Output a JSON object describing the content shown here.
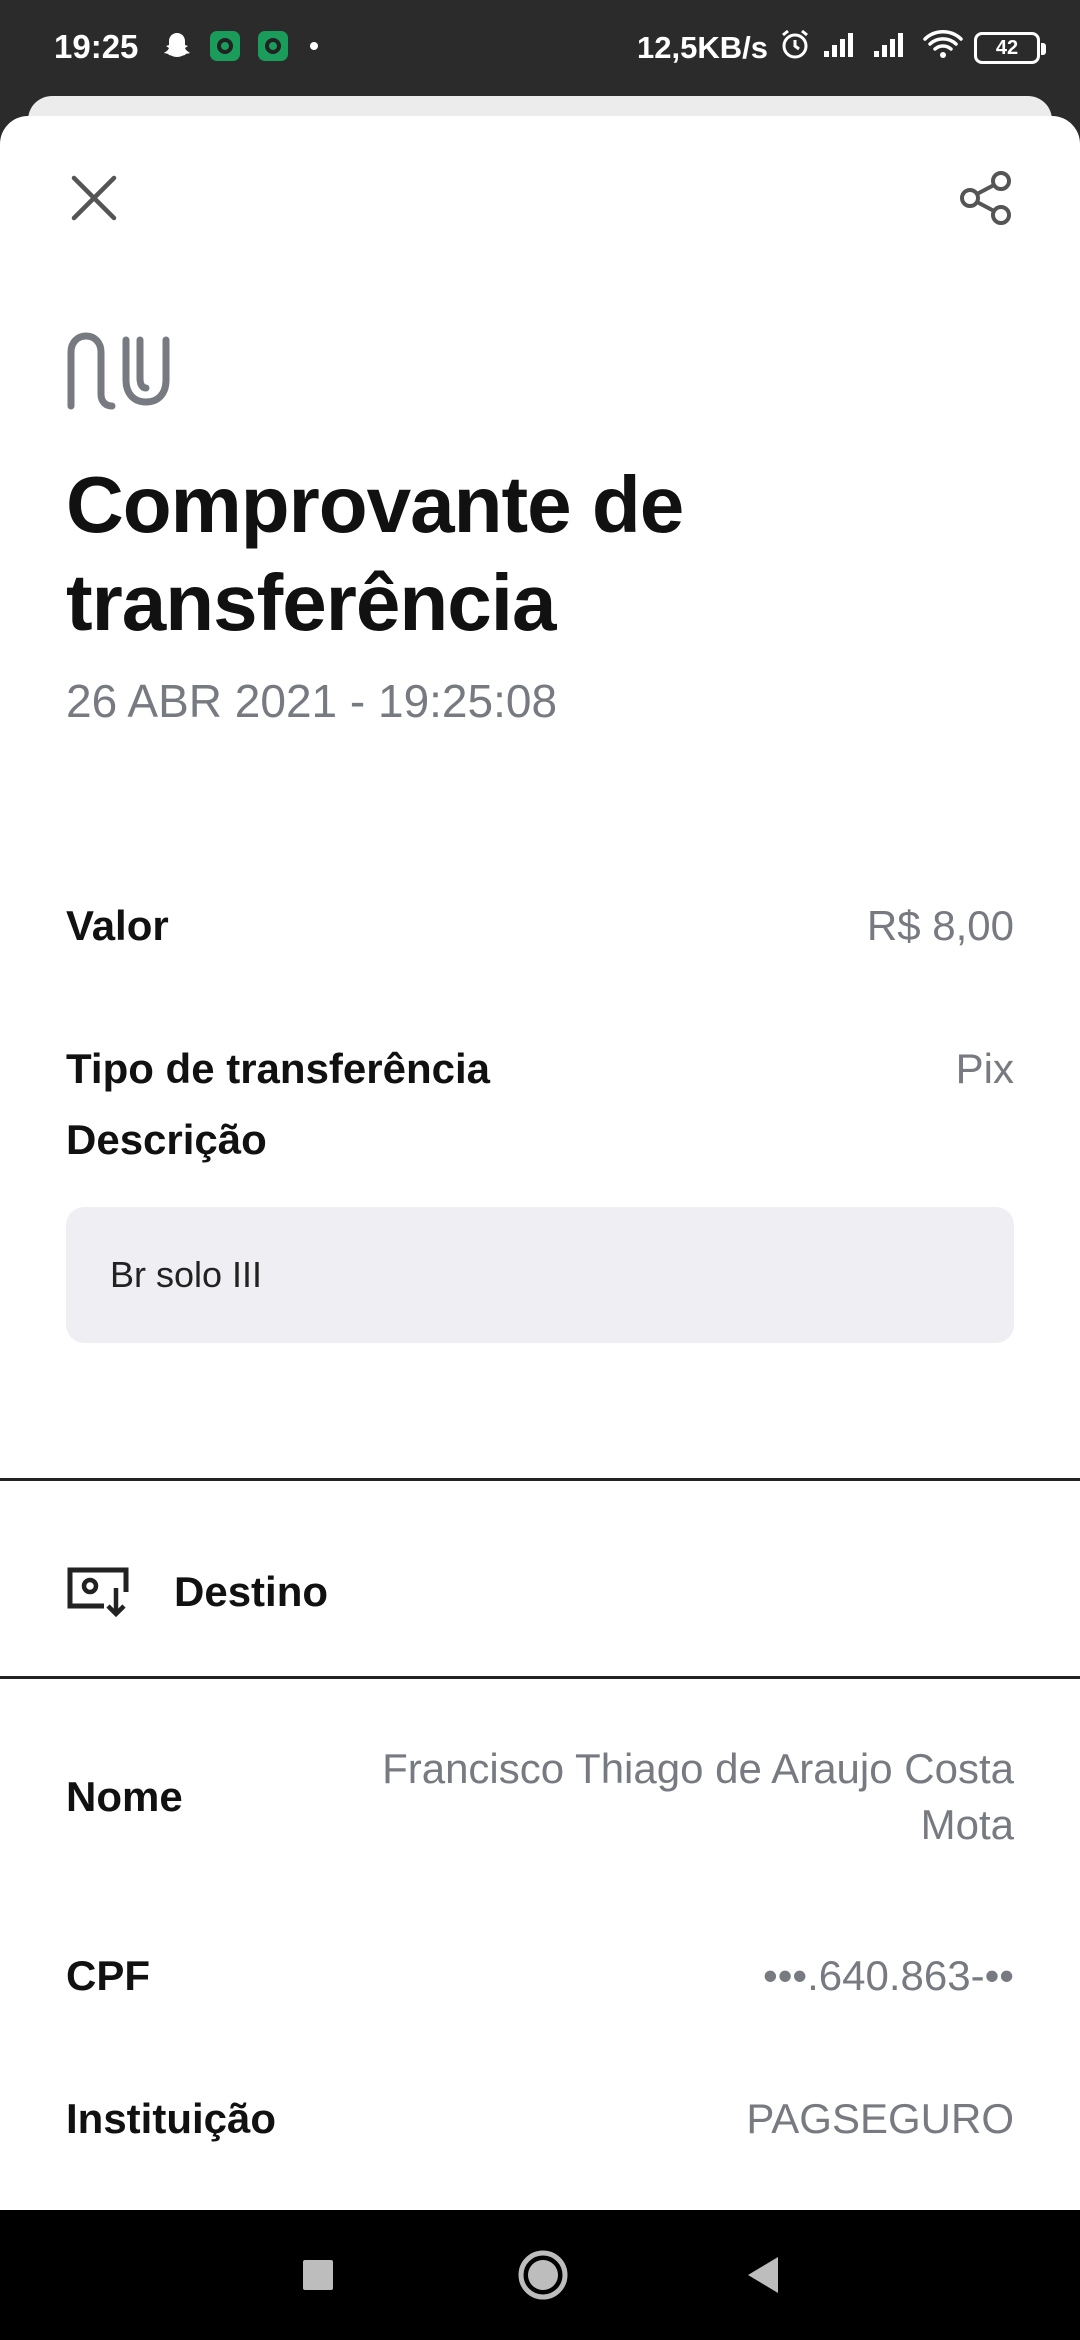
{
  "status_bar": {
    "time": "19:25",
    "network_speed": "12,5KB/s",
    "battery_level": "42",
    "notification_icons": [
      "snapchat-icon",
      "app-icon",
      "app-icon",
      "dot-icon"
    ],
    "system_icons": [
      "alarm-icon",
      "signal-icon",
      "signal-icon",
      "wifi-icon",
      "battery-icon"
    ]
  },
  "toolbar": {
    "close_icon": "close-icon",
    "share_icon": "share-icon"
  },
  "logo": "nu",
  "header": {
    "title": "Comprovante de transferência",
    "date": "26 ABR 2021 - 19:25:08"
  },
  "details": {
    "valor_label": "Valor",
    "valor_value": "R$ 8,00",
    "tipo_label": "Tipo de transferência",
    "tipo_value": "Pix",
    "descricao_label": "Descrição",
    "descricao_value": "Br solo III"
  },
  "destino": {
    "icon": "receive-money-icon",
    "title": "Destino",
    "nome_label": "Nome",
    "nome_value": "Francisco Thiago de Araujo Costa Mota",
    "cpf_label": "CPF",
    "cpf_value": "•••.640.863-••",
    "instituicao_label": "Instituição",
    "instituicao_value": "PAGSEGURO"
  },
  "nav_bar": {
    "items": [
      "recent-apps-icon",
      "home-icon",
      "back-icon"
    ]
  },
  "colors": {
    "status_bar_bg": "#2b2b2b",
    "sheet_bg": "#ffffff",
    "text_primary": "#111111",
    "text_secondary": "#777a80",
    "description_bg": "#efeff3",
    "nav_bar_bg": "#000000"
  }
}
